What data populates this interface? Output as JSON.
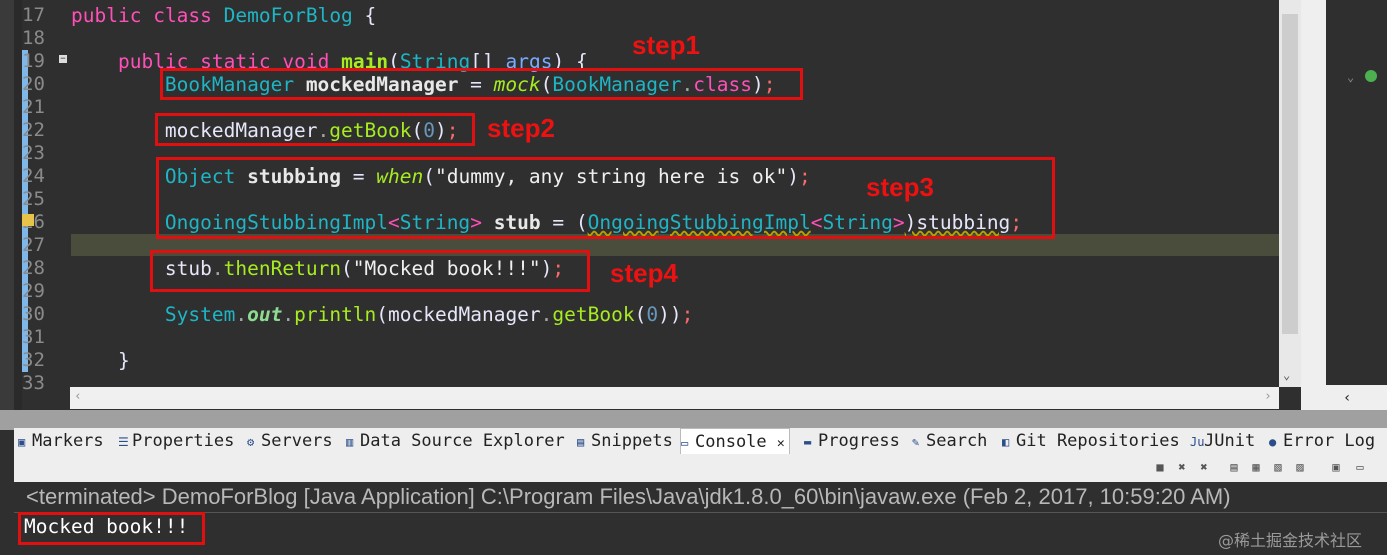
{
  "editor": {
    "line_numbers": [
      "17",
      "18",
      "19",
      "20",
      "21",
      "22",
      "23",
      "24",
      "25",
      "26",
      "27",
      "28",
      "29",
      "30",
      "31",
      "32",
      "33"
    ],
    "lines": {
      "l17": {
        "kw1": "public",
        "kw2": "class",
        "name": "DemoForBlog",
        "brace": "{"
      },
      "l19": {
        "kw1": "public",
        "kw2": "static",
        "kw3": "void",
        "meth": "main",
        "p1": "(",
        "type": "String",
        "p2": "[] ",
        "arg": "args",
        "p3": ") {"
      },
      "l20": {
        "type": "BookManager",
        "var": "mockedManager",
        "eq": " = ",
        "call": "mock",
        "p1": "(",
        "type2": "BookManager",
        "dot": ".",
        "kw": "class",
        "p2": ")",
        "semi": ";"
      },
      "l22": {
        "obj": "mockedManager",
        "dot": ".",
        "meth": "getBook",
        "p1": "(",
        "num": "0",
        "p2": ")",
        "semi": ";"
      },
      "l24": {
        "type": "Object",
        "var": "stubbing",
        "eq": " = ",
        "call": "when",
        "p1": "(",
        "str": "\"dummy, any string here is ok\"",
        "p2": ")",
        "semi": ";"
      },
      "l26": {
        "type": "OngoingStubbingImpl",
        "lt": "<",
        "type2": "String",
        "gt": ">",
        "var": "stub",
        "eq": " = (",
        "type3": "OngoingStubbingImpl",
        "lt2": "<",
        "type4": "String",
        "gt2": ">",
        "rest": ")stubbing",
        "semi": ";"
      },
      "l28": {
        "obj": "stub",
        "dot": ".",
        "meth": "thenReturn",
        "p1": "(",
        "str": "\"Mocked book!!!\"",
        "p2": ")",
        "semi": ";"
      },
      "l30": {
        "sys": "System",
        "dot": ".",
        "field": "out",
        "dot2": ".",
        "meth": "println",
        "p1": "(",
        "obj": "mockedManager",
        "dot3": ".",
        "meth2": "getBook",
        "p2": "(",
        "num": "0",
        "p3": "))",
        "semi": ";"
      },
      "l32": {
        "brace": "}"
      }
    }
  },
  "annotations": {
    "step1": "step1",
    "step2": "step2",
    "step3": "step3",
    "step4": "step4"
  },
  "bottom_tabs": [
    {
      "label": "Markers",
      "icon": "markers-icon"
    },
    {
      "label": "Properties",
      "icon": "properties-icon"
    },
    {
      "label": "Servers",
      "icon": "servers-icon"
    },
    {
      "label": "Data Source Explorer",
      "icon": "data-source-icon"
    },
    {
      "label": "Snippets",
      "icon": "snippets-icon"
    },
    {
      "label": "Console",
      "icon": "console-icon",
      "active": true
    },
    {
      "label": "Progress",
      "icon": "progress-icon"
    },
    {
      "label": "Search",
      "icon": "search-icon"
    },
    {
      "label": "Git Repositories",
      "icon": "git-icon"
    },
    {
      "label": "JUnit",
      "icon": "junit-icon"
    },
    {
      "label": "Error Log",
      "icon": "error-log-icon"
    }
  ],
  "console": {
    "terminated": "<terminated> DemoForBlog [Java Application] C:\\Program Files\\Java\\jdk1.8.0_60\\bin\\javaw.exe (Feb 2, 2017, 10:59:20 AM)",
    "output": "Mocked book!!!"
  },
  "watermark": "@稀土掘金技术社区",
  "colors": {
    "editor_bg": "#2f2f2f",
    "annotation_red": "#e01010",
    "keyword": "#ff4fb8",
    "type": "#1eb5c5",
    "method": "#a7ec21"
  }
}
